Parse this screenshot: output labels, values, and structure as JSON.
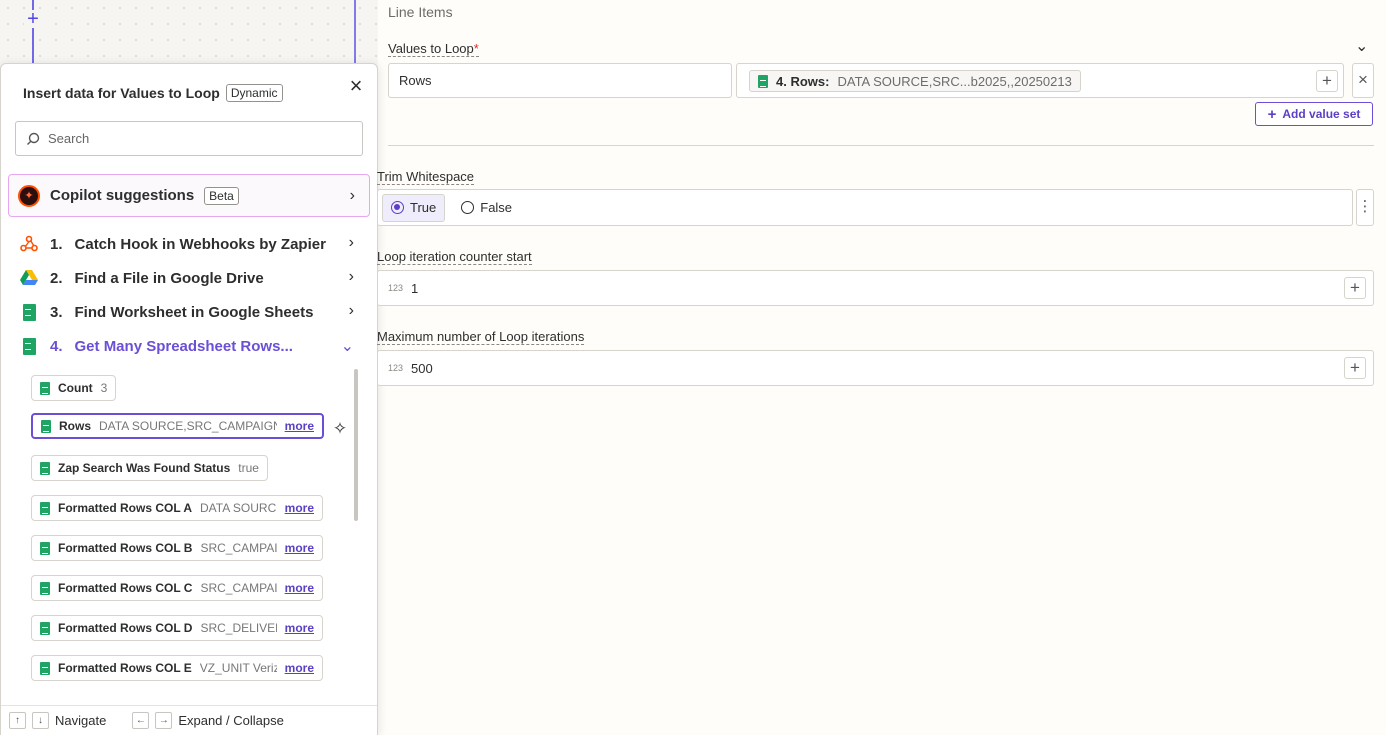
{
  "popover": {
    "title": "Insert data for Values to Loop",
    "badge": "Dynamic",
    "search_placeholder": "Search",
    "copilot": {
      "label": "Copilot suggestions",
      "badge": "Beta"
    },
    "steps": [
      {
        "num": "1.",
        "name": "Catch Hook in Webhooks by Zapier",
        "icon": "webhook-icon"
      },
      {
        "num": "2.",
        "name": "Find a File in Google Drive",
        "icon": "google-drive-icon"
      },
      {
        "num": "3.",
        "name": "Find Worksheet in Google Sheets",
        "icon": "google-sheets-icon"
      },
      {
        "num": "4.",
        "name": "Get Many Spreadsheet Rows...",
        "icon": "google-sheets-icon"
      }
    ],
    "fields": [
      {
        "label": "Count",
        "value": "3",
        "more": ""
      },
      {
        "label": "Rows",
        "value": "DATA SOURCE,SRC_CAMPAIGN",
        "more": "more"
      },
      {
        "label": "Zap Search Was Found Status",
        "value": "true",
        "more": ""
      },
      {
        "label": "Formatted Rows COL A",
        "value": "DATA SOURCE",
        "more": "more"
      },
      {
        "label": "Formatted Rows COL B",
        "value": "SRC_CAMPAIGN",
        "more": "more"
      },
      {
        "label": "Formatted Rows COL C",
        "value": "SRC_CAMPAIGN",
        "more": "more"
      },
      {
        "label": "Formatted Rows COL D",
        "value": "SRC_DELIVERY",
        "more": "more"
      },
      {
        "label": "Formatted Rows COL E",
        "value": "VZ_UNIT Verizon",
        "more": "more"
      }
    ],
    "footer": {
      "navigate": "Navigate",
      "expand": "Expand / Collapse",
      "key_up": "↑",
      "key_down": "↓",
      "key_left": "←",
      "key_right": "→"
    }
  },
  "form": {
    "section_title": "Line Items",
    "values_to_loop": {
      "label": "Values to Loop",
      "required_mark": "*",
      "key": "Rows",
      "chip_label": "4. Rows:",
      "chip_value": "DATA SOURCE,SRC...b2025,,20250213",
      "add_label": "Add value set"
    },
    "trim": {
      "label": "Trim Whitespace",
      "true_label": "True",
      "false_label": "False",
      "selected": "True"
    },
    "counter": {
      "label": "Loop iteration counter start",
      "type_tag": "123",
      "value": "1"
    },
    "max": {
      "label": "Maximum number of Loop iterations",
      "type_tag": "123",
      "value": "500"
    }
  },
  "colors": {
    "accent": "#6b4fd6",
    "sheets_green": "#1fa463",
    "zapier_orange": "#ff4f00"
  }
}
